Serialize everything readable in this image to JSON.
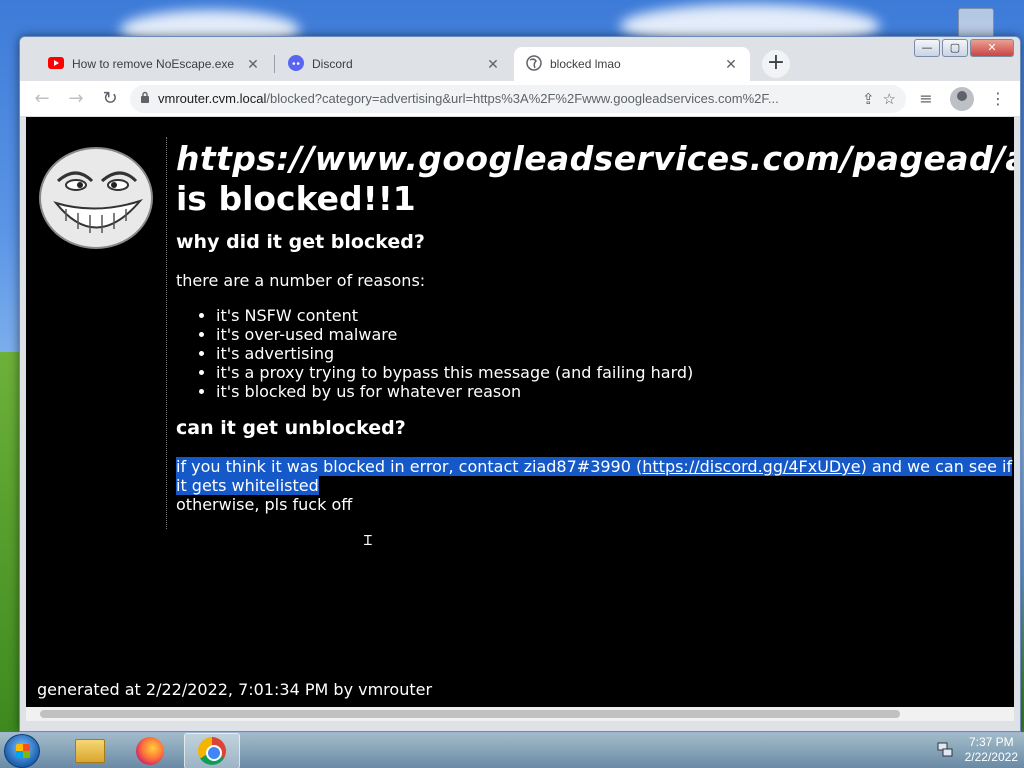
{
  "browser": {
    "tabs": [
      {
        "icon": "youtube-icon",
        "title": "How to remove NoEscape.exe [D",
        "close": "✕"
      },
      {
        "icon": "discord-icon",
        "title": "Discord",
        "close": "✕"
      },
      {
        "icon": "globe-icon",
        "title": "blocked lmao",
        "close": "✕"
      }
    ],
    "new_tab": "+",
    "window_controls": {
      "minimize": "—",
      "maximize": "▢",
      "close": "✕"
    },
    "address_host": "vmrouter.cvm.local",
    "address_path": "/blocked?category=advertising&url=https%3A%2F%2Fwww.googleadservices.com%2F..."
  },
  "page": {
    "blocked_url": "https://www.googleadservices.com/pagead/a",
    "blocked_suffix": "is blocked!!1",
    "why_heading": "why did it get blocked?",
    "reasons_intro": "there are a number of reasons:",
    "reasons": [
      "it's NSFW content",
      "it's over-used malware",
      "it's advertising",
      "it's a proxy trying to bypass this message (and failing hard)",
      "it's blocked by us for whatever reason"
    ],
    "unblock_heading": "can it get unblocked?",
    "unblock_text_1": "if you think it was blocked in error, contact ziad87#3990 (",
    "discord_link": "https://discord.gg/4FxUDye",
    "unblock_text_2": ") and we can see if it gets whitelisted",
    "otherwise": "otherwise, pls fuck off",
    "footer": "generated at 2/22/2022, 7:01:34 PM by vmrouter"
  },
  "taskbar": {
    "time": "7:37 PM",
    "date": "2/22/2022"
  },
  "colors": {
    "selection": "#1559c9",
    "page_bg": "#000000",
    "page_text": "#ffffff"
  }
}
